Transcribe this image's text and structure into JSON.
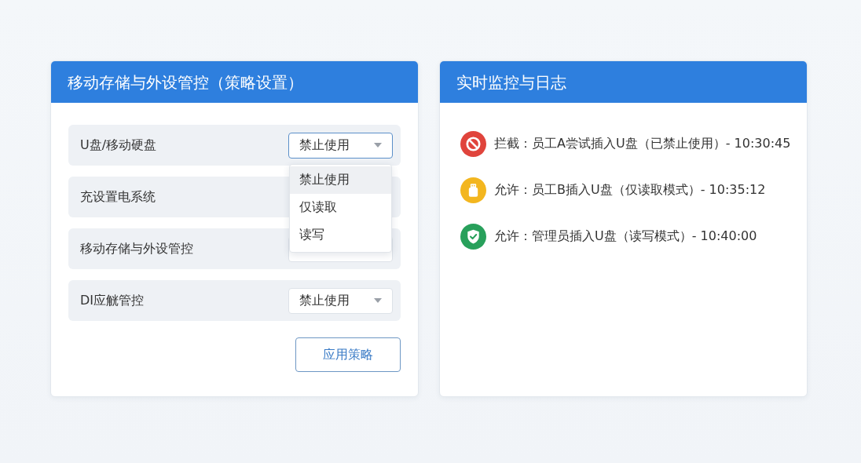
{
  "policy_panel": {
    "title": "移动存储与外设管控（策略设置）",
    "rows": [
      {
        "label": "U盘/移动硬盘",
        "select": {
          "value": "禁止使用",
          "expanded": true,
          "options": [
            {
              "label": "禁止使用",
              "selected": true
            },
            {
              "label": "仅读取",
              "selected": false
            },
            {
              "label": "读写",
              "selected": false
            }
          ]
        }
      },
      {
        "label": "充设置电系统"
      },
      {
        "label": "移动存储与外设管控",
        "select": {
          "expanded": false
        }
      },
      {
        "label": "DI应觥管控",
        "select": {
          "value": "禁止使用",
          "expanded": false
        }
      }
    ],
    "apply_button": "应用策略"
  },
  "log_panel": {
    "title": "实时监控与日志",
    "entries": [
      {
        "kind": "blocked",
        "text": "拦截：员工A尝试插入U盘（已禁止使用）- 10:30:45"
      },
      {
        "kind": "read_only",
        "text": "允许：员工B插入U盘（仅读取模式）- 10:35:12"
      },
      {
        "kind": "read_write",
        "text": "允许：管理员插入U盘（读写模式）- 10:40:00"
      }
    ]
  }
}
